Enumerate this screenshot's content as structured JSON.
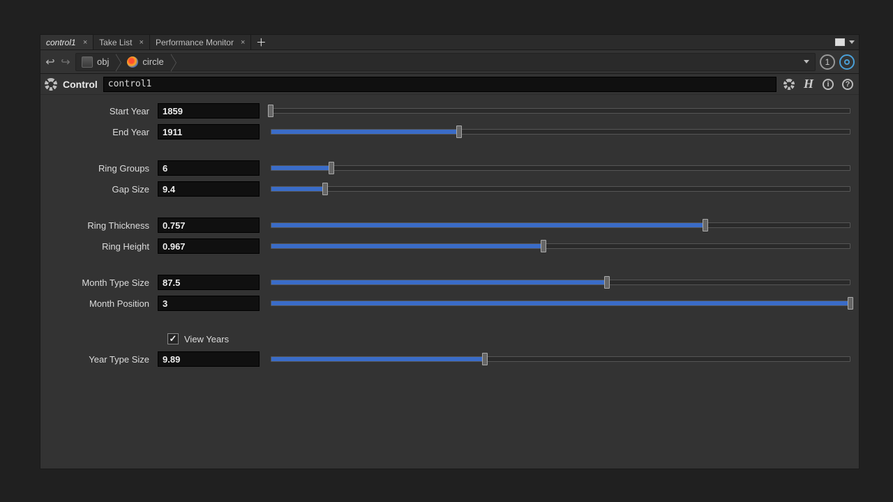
{
  "tabs": [
    {
      "label": "control1",
      "active": true
    },
    {
      "label": "Take List",
      "active": false
    },
    {
      "label": "Performance Monitor",
      "active": false
    }
  ],
  "breadcrumb": {
    "root": "obj",
    "node": "circle"
  },
  "pin_count": "1",
  "node": {
    "type_label": "Control",
    "name": "control1"
  },
  "params": {
    "start_year": {
      "label": "Start Year",
      "value": "1859",
      "pct": 0.0
    },
    "end_year": {
      "label": "End Year",
      "value": "1911",
      "pct": 32.5
    },
    "ring_groups": {
      "label": "Ring Groups",
      "value": "6",
      "pct": 10.5
    },
    "gap_size": {
      "label": "Gap Size",
      "value": "9.4",
      "pct": 9.4
    },
    "ring_thickness": {
      "label": "Ring Thickness",
      "value": "0.757",
      "pct": 75.0
    },
    "ring_height": {
      "label": "Ring Height",
      "value": "0.967",
      "pct": 47.0
    },
    "month_type_size": {
      "label": "Month Type Size",
      "value": "87.5",
      "pct": 58.0
    },
    "month_position": {
      "label": "Month Position",
      "value": "3",
      "pct": 100.0
    },
    "view_years": {
      "label": "View Years",
      "checked": true
    },
    "year_type_size": {
      "label": "Year Type Size",
      "value": "9.89",
      "pct": 37.0
    }
  }
}
